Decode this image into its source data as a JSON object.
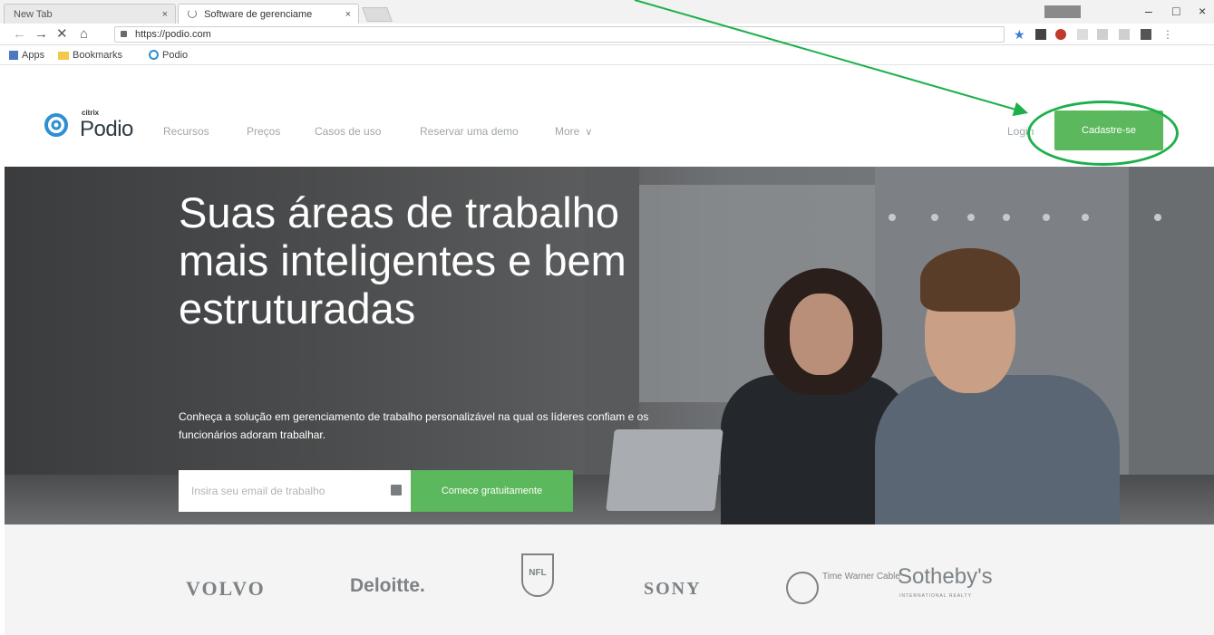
{
  "browser": {
    "tabs": [
      {
        "label": "New Tab",
        "close": "×"
      },
      {
        "label": "Software de gerenciame",
        "close": "×"
      }
    ],
    "window_controls": {
      "minimize": "–",
      "maximize": "□",
      "close": "×"
    },
    "url": "https://podio.com",
    "bookmarks": [
      {
        "label": "Apps",
        "icon": "apps-icon"
      },
      {
        "label": "Bookmarks",
        "icon": "folder-icon"
      },
      {
        "label": "Podio",
        "icon": "podio-icon"
      }
    ]
  },
  "site": {
    "logo": {
      "brand_small": "citrix",
      "name": "Podio"
    },
    "nav": [
      "Recursos",
      "Preços",
      "Casos de uso",
      "Reservar uma demo",
      "More"
    ],
    "login": "Login",
    "signup": "Cadastre-se"
  },
  "hero": {
    "title": "Suas áreas de trabalho mais inteligentes e bem estruturadas",
    "subtitle": "Conheça a solução em gerenciamento de trabalho personalizável na qual os líderes confiam e os funcionários adoram trabalhar.",
    "email_placeholder": "Insira seu email de trabalho",
    "cta": "Comece gratuitamente"
  },
  "logos": {
    "volvo": "VOLVO",
    "deloitte": "Deloitte.",
    "nfl": "NFL",
    "sony": "SONY",
    "twc": "Time Warner Cable",
    "sothebys": "Sotheby's",
    "sothebys_sub": "INTERNATIONAL REALTY"
  },
  "colors": {
    "accent_green": "#5cb85c",
    "annotation_green": "#1db04a",
    "logo_blue": "#2f8fd1"
  }
}
